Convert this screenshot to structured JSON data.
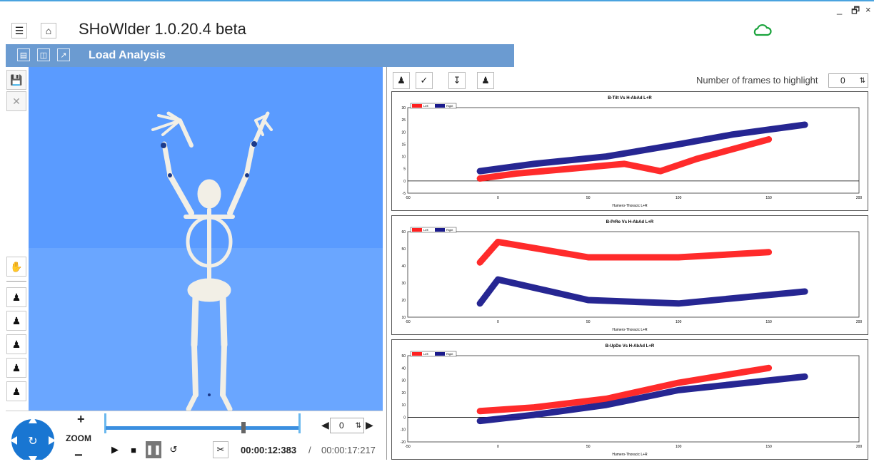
{
  "app": {
    "title": "SHoWlder 1.0.20.4 beta",
    "window_controls": [
      "_",
      "🗗",
      "×"
    ]
  },
  "module": {
    "title": "Load Analysis"
  },
  "colors": {
    "accent": "#6b9bd1",
    "viewport": "#5a9bff",
    "left_series": "#ff2020",
    "right_series": "#1a1a8c",
    "cloud": "#1aa33c"
  },
  "icons": {
    "menu": "hamburger-icon",
    "home": "home-icon",
    "cloud": "cloud-icon",
    "module_buttons": [
      "panel-icon",
      "export-icon",
      "external-link-icon"
    ],
    "left_tools": [
      "save-icon",
      "close-icon"
    ],
    "view_tools": [
      "hand-icon",
      "body-front-icon",
      "body-side-icon",
      "body-walk-icon",
      "body-arms-icon",
      "body-stand-icon"
    ]
  },
  "playback": {
    "zoom_label": "ZOOM",
    "zoom_plus": "+",
    "zoom_minus": "−",
    "frame_value": "0",
    "current_time": "00:00:12:383",
    "separator": "/",
    "total_time": "00:00:17:217",
    "progress": 0.71
  },
  "highlight": {
    "label": "Number of frames to highlight",
    "value": "0"
  },
  "chart_data": [
    {
      "type": "line",
      "title": "B-Tilt Vs H-AbAd L+R",
      "xlabel": "Humero-Thoracic L+R",
      "legend": [
        "Left",
        "Right"
      ],
      "xlim": [
        -50,
        200
      ],
      "ylim": [
        -5,
        30
      ],
      "xticks": [
        "-50",
        "0",
        "50",
        "100",
        "150",
        "200"
      ],
      "yticks": [
        "-5",
        "0",
        "5",
        "10",
        "15",
        "20",
        "25",
        "30"
      ],
      "series": [
        {
          "name": "Left",
          "x": [
            -10,
            10,
            40,
            70,
            90,
            110,
            150
          ],
          "y": [
            1,
            3,
            5,
            7,
            4,
            9,
            17
          ]
        },
        {
          "name": "Right",
          "x": [
            -10,
            20,
            60,
            100,
            130,
            170
          ],
          "y": [
            4,
            7,
            10,
            15,
            19,
            23
          ]
        }
      ]
    },
    {
      "type": "line",
      "title": "B-PrRe Vs H-AbAd L+R",
      "xlabel": "Humero-Thoracic L+R",
      "legend": [
        "Left",
        "Right"
      ],
      "xlim": [
        -50,
        200
      ],
      "ylim": [
        10,
        60
      ],
      "xticks": [
        "-50",
        "0",
        "50",
        "100",
        "150",
        "200"
      ],
      "yticks": [
        "10",
        "20",
        "30",
        "40",
        "50",
        "60"
      ],
      "series": [
        {
          "name": "Left",
          "x": [
            -10,
            0,
            50,
            100,
            150
          ],
          "y": [
            42,
            54,
            45,
            45,
            48
          ]
        },
        {
          "name": "Right",
          "x": [
            -10,
            0,
            50,
            100,
            170
          ],
          "y": [
            18,
            32,
            20,
            18,
            25
          ]
        }
      ]
    },
    {
      "type": "line",
      "title": "B-UpDo Vs H-AbAd L+R",
      "xlabel": "Humero-Thoracic L+R",
      "legend": [
        "Left",
        "Right"
      ],
      "xlim": [
        -50,
        200
      ],
      "ylim": [
        -20,
        50
      ],
      "xticks": [
        "-50",
        "0",
        "50",
        "100",
        "150",
        "200"
      ],
      "yticks": [
        "-20",
        "-10",
        "0",
        "10",
        "20",
        "30",
        "40",
        "50"
      ],
      "series": [
        {
          "name": "Left",
          "x": [
            -10,
            20,
            60,
            100,
            150
          ],
          "y": [
            5,
            8,
            15,
            28,
            40
          ]
        },
        {
          "name": "Right",
          "x": [
            -10,
            20,
            60,
            100,
            170
          ],
          "y": [
            -3,
            2,
            10,
            22,
            33
          ]
        }
      ]
    }
  ]
}
